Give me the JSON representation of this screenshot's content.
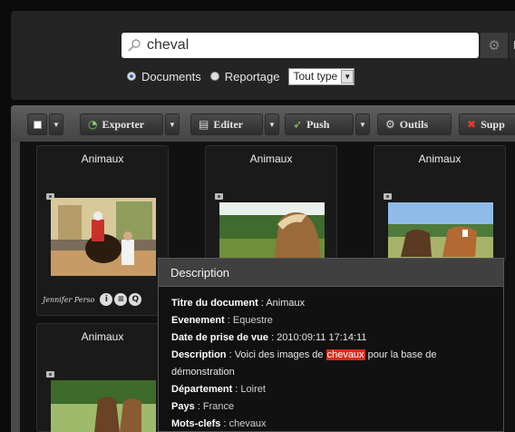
{
  "search": {
    "query": "cheval",
    "next_label": "F"
  },
  "filters": {
    "documents_label": "Documents",
    "reportage_label": "Reportage",
    "type_select": "Tout type"
  },
  "toolbar": {
    "exporter": "Exporter",
    "editer": "Editer",
    "push": "Push",
    "outils": "Outils",
    "supprimer": "Supp"
  },
  "cards": [
    {
      "title": "Animaux",
      "signature": "Jennifer Perso"
    },
    {
      "title": "Animaux"
    },
    {
      "title": "Animaux"
    },
    {
      "title": "Animaux"
    }
  ],
  "tooltip": {
    "header": "Description",
    "titre_label": "Titre du document",
    "titre_value": "Animaux",
    "evenement_label": "Evenement",
    "evenement_value": "Equestre",
    "date_label": "Date de prise de vue",
    "date_value": "2010:09:11 17:14:11",
    "description_label": "Description",
    "description_before": "Voici des images de ",
    "description_highlight": "chevaux",
    "description_after": " pour la base de",
    "description_line2": "démonstration",
    "departement_label": "Département",
    "departement_value": "Loiret",
    "pays_label": "Pays",
    "pays_value": "France",
    "mots_label": "Mots-clefs",
    "mots_value": "chevaux"
  }
}
